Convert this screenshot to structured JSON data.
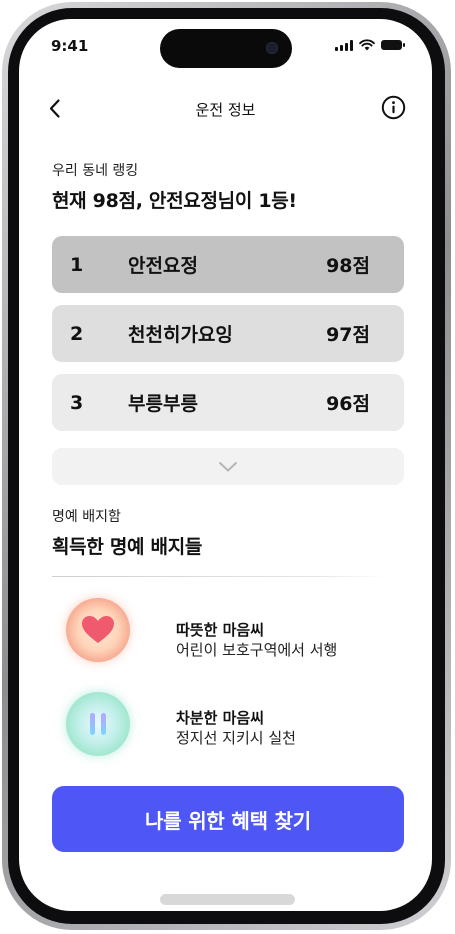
{
  "status_bar": {
    "time": "9:41"
  },
  "nav": {
    "title": "운전 정보"
  },
  "ranking": {
    "subtitle": "우리 동네 랭킹",
    "headline": "현재 98점, 안전요정님이 1등!",
    "items": [
      {
        "rank": "1",
        "name": "안전요정",
        "score": "98점",
        "bg": "#c2c2c2"
      },
      {
        "rank": "2",
        "name": "천천히가요잉",
        "score": "97점",
        "bg": "#dedede"
      },
      {
        "rank": "3",
        "name": "부릉부릉",
        "score": "96점",
        "bg": "#ebebeb"
      }
    ]
  },
  "badges": {
    "subtitle": "명예 배지함",
    "headline": "획득한 명예 배지들",
    "items": [
      {
        "title": "따뜻한 마음씨",
        "desc": "어린이 보호구역에서 서행",
        "icon": "heart-icon"
      },
      {
        "title": "차분한 마음씨",
        "desc": "정지선 지키시 실천",
        "icon": "pause-icon"
      }
    ]
  },
  "cta": {
    "label": "나를 위한 혜택 찾기"
  },
  "colors": {
    "accent": "#4f56f6",
    "heart": "#ef5a6f"
  }
}
